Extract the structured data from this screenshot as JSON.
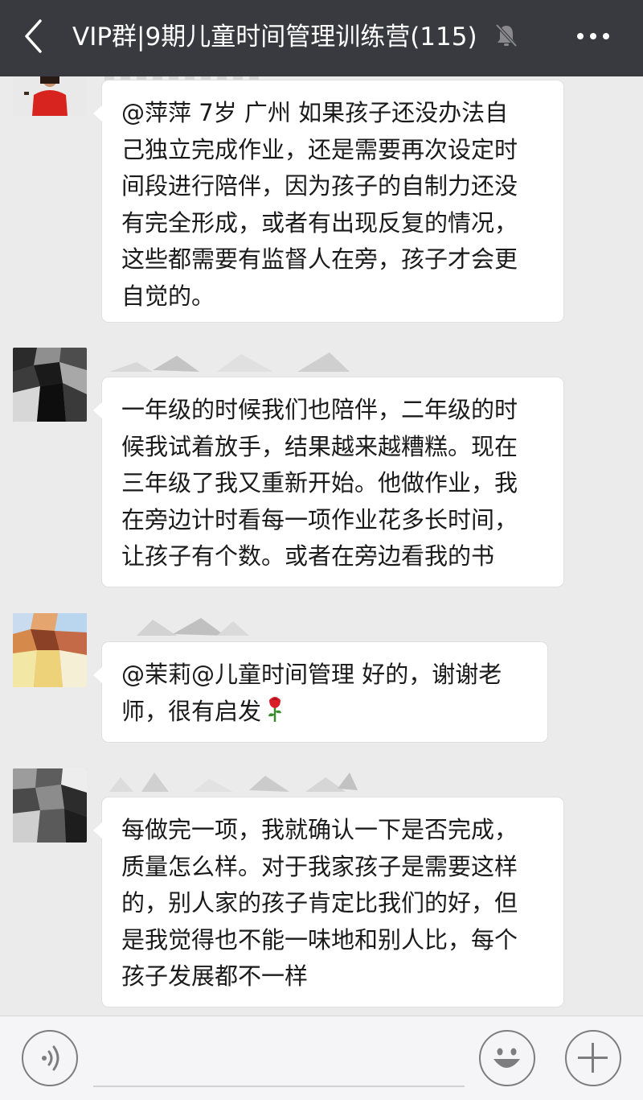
{
  "header": {
    "title": "VIP群|9期儿童时间管理训练营(115)",
    "back_icon": "chevron-left-icon",
    "mute_icon": "bell-muted-icon",
    "more_icon": "more-dots-icon",
    "bg_color": "#393a3f"
  },
  "messages": [
    {
      "sender": "",
      "text_lines": [
        "@萍萍 7岁 广州 如果孩子还没办法自",
        "己独立完成作业，还是需要再次设定时",
        "间段进行陪伴，因为孩子的自制力还没",
        "有完全形成，或者有出现反复的情况，",
        "这些都需要有监督人在旁，孩子才会更",
        "自觉的。"
      ]
    },
    {
      "sender": "",
      "text_lines": [
        "一年级的时候我们也陪伴，二年级的时",
        "候我试着放手，结果越来越糟糕。现在",
        "三年级了我又重新开始。他做作业，我",
        "在旁边计时看每一项作业花多长时间，",
        "让孩子有个数。或者在旁边看我的书"
      ]
    },
    {
      "sender": "",
      "text_lines": [
        "@茉莉@儿童时间管理  好的，谢谢老",
        "师，很有启发"
      ],
      "emoji": "rose-icon"
    },
    {
      "sender": "",
      "text_lines": [
        "每做完一项，我就确认一下是否完成，",
        "质量怎么样。对于我家孩子是需要这样",
        "的，别人家的孩子肯定比我们的好，但",
        "是我觉得也不能一味地和别人比，每个",
        "孩子发展都不一样"
      ]
    }
  ],
  "input_bar": {
    "voice_icon": "voice-icon",
    "emoji_icon": "smiley-icon",
    "plus_icon": "plus-icon",
    "placeholder": ""
  }
}
